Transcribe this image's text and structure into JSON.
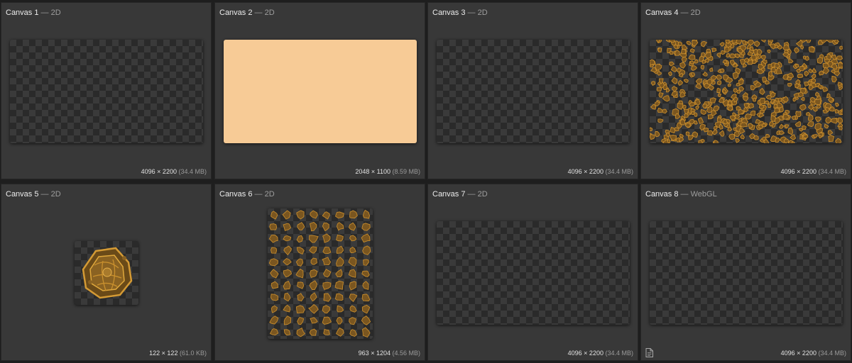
{
  "colors": {
    "panel_bg": "#383838",
    "peach_fill": "#f7cb96",
    "paint_orange": "#c48a2c"
  },
  "canvases": [
    {
      "name": "Canvas 1",
      "separator": "—",
      "context": "2D",
      "dimensions": "4096 × 2200",
      "size": "(34.4 MB)",
      "content": "empty"
    },
    {
      "name": "Canvas 2",
      "separator": "—",
      "context": "2D",
      "dimensions": "2048 × 1100",
      "size": "(8.59 MB)",
      "content": "solid-fill"
    },
    {
      "name": "Canvas 3",
      "separator": "—",
      "context": "2D",
      "dimensions": "4096 × 2200",
      "size": "(34.4 MB)",
      "content": "empty"
    },
    {
      "name": "Canvas 4",
      "separator": "—",
      "context": "2D",
      "dimensions": "4096 × 2200",
      "size": "(34.4 MB)",
      "content": "scattered-sprites"
    },
    {
      "name": "Canvas 5",
      "separator": "—",
      "context": "2D",
      "dimensions": "122 × 122",
      "size": "(61.0 KB)",
      "content": "single-sprite"
    },
    {
      "name": "Canvas 6",
      "separator": "—",
      "context": "2D",
      "dimensions": "963 × 1204",
      "size": "(4.56 MB)",
      "content": "sprite-sheet"
    },
    {
      "name": "Canvas 7",
      "separator": "—",
      "context": "2D",
      "dimensions": "4096 × 2200",
      "size": "(34.4 MB)",
      "content": "empty"
    },
    {
      "name": "Canvas 8",
      "separator": "—",
      "context": "WebGL",
      "dimensions": "4096 × 2200",
      "size": "(34.4 MB)",
      "content": "empty",
      "icon": "document-icon"
    }
  ]
}
